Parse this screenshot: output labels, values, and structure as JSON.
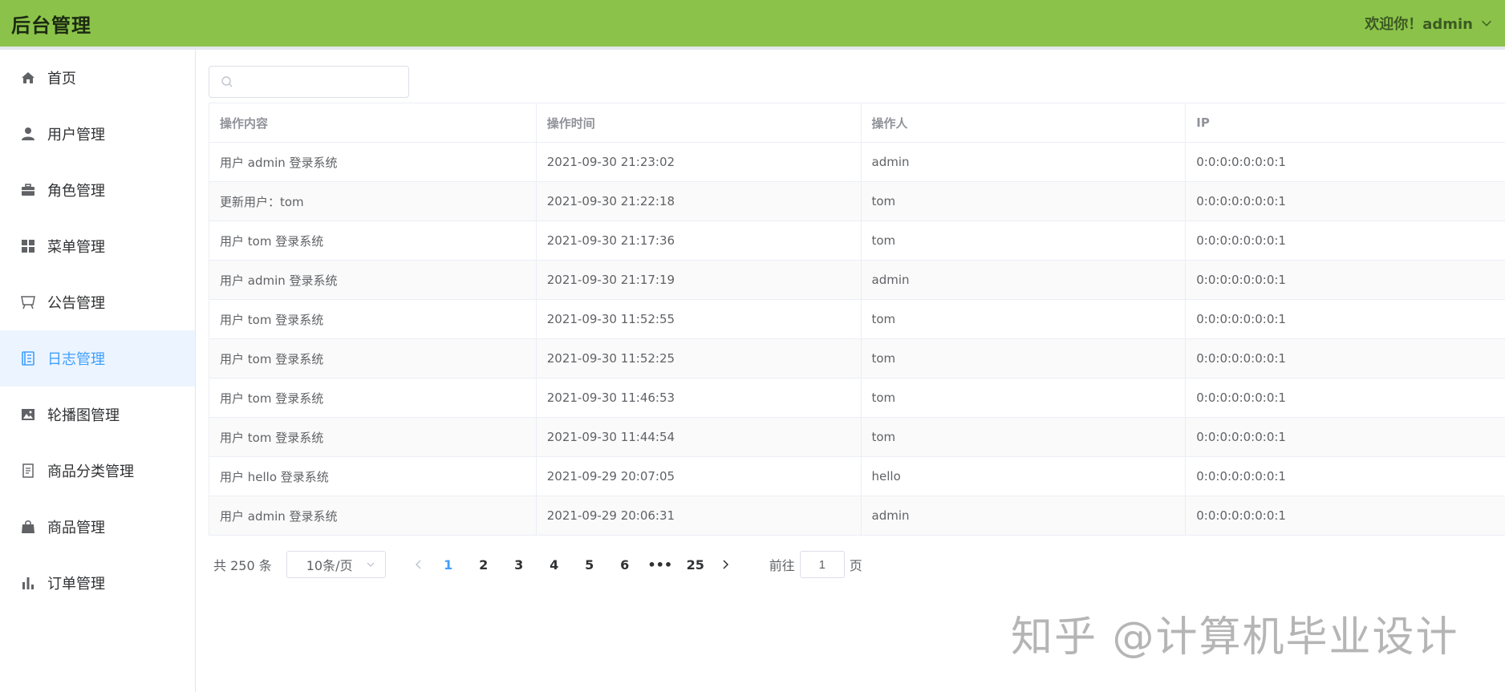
{
  "header": {
    "title": "后台管理",
    "user": "欢迎你！admin"
  },
  "sidebar": {
    "items": [
      {
        "label": "首页",
        "icon": "home-icon"
      },
      {
        "label": "用户管理",
        "icon": "user-icon"
      },
      {
        "label": "角色管理",
        "icon": "briefcase-icon"
      },
      {
        "label": "菜单管理",
        "icon": "grid-icon"
      },
      {
        "label": "公告管理",
        "icon": "board-icon"
      },
      {
        "label": "日志管理",
        "icon": "notebook-icon"
      },
      {
        "label": "轮播图管理",
        "icon": "picture-icon"
      },
      {
        "label": "商品分类管理",
        "icon": "document-icon"
      },
      {
        "label": "商品管理",
        "icon": "bag-icon"
      },
      {
        "label": "订单管理",
        "icon": "bar-chart-icon"
      }
    ],
    "active_index": 5
  },
  "search": {
    "value": "",
    "placeholder": ""
  },
  "table": {
    "headers": [
      "操作内容",
      "操作时间",
      "操作人",
      "IP"
    ],
    "rows": [
      [
        "用户 admin 登录系统",
        "2021-09-30 21:23:02",
        "admin",
        "0:0:0:0:0:0:0:1"
      ],
      [
        "更新用户：tom",
        "2021-09-30 21:22:18",
        "tom",
        "0:0:0:0:0:0:0:1"
      ],
      [
        "用户 tom 登录系统",
        "2021-09-30 21:17:36",
        "tom",
        "0:0:0:0:0:0:0:1"
      ],
      [
        "用户 admin 登录系统",
        "2021-09-30 21:17:19",
        "admin",
        "0:0:0:0:0:0:0:1"
      ],
      [
        "用户 tom 登录系统",
        "2021-09-30 11:52:55",
        "tom",
        "0:0:0:0:0:0:0:1"
      ],
      [
        "用户 tom 登录系统",
        "2021-09-30 11:52:25",
        "tom",
        "0:0:0:0:0:0:0:1"
      ],
      [
        "用户 tom 登录系统",
        "2021-09-30 11:46:53",
        "tom",
        "0:0:0:0:0:0:0:1"
      ],
      [
        "用户 tom 登录系统",
        "2021-09-30 11:44:54",
        "tom",
        "0:0:0:0:0:0:0:1"
      ],
      [
        "用户 hello 登录系统",
        "2021-09-29 20:07:05",
        "hello",
        "0:0:0:0:0:0:0:1"
      ],
      [
        "用户 admin 登录系统",
        "2021-09-29 20:06:31",
        "admin",
        "0:0:0:0:0:0:0:1"
      ]
    ]
  },
  "pagination": {
    "total_text": "共 250 条",
    "page_size": "10条/页",
    "pages": [
      "1",
      "2",
      "3",
      "4",
      "5",
      "6",
      "•••",
      "25"
    ],
    "current": "1",
    "goto_prefix": "前往",
    "goto_value": "1",
    "goto_suffix": "页"
  },
  "watermark": "知乎 @计算机毕业设计",
  "colors": {
    "header_bg": "#8bc34a",
    "accent": "#409eff",
    "active_bg": "#ecf5ff"
  }
}
